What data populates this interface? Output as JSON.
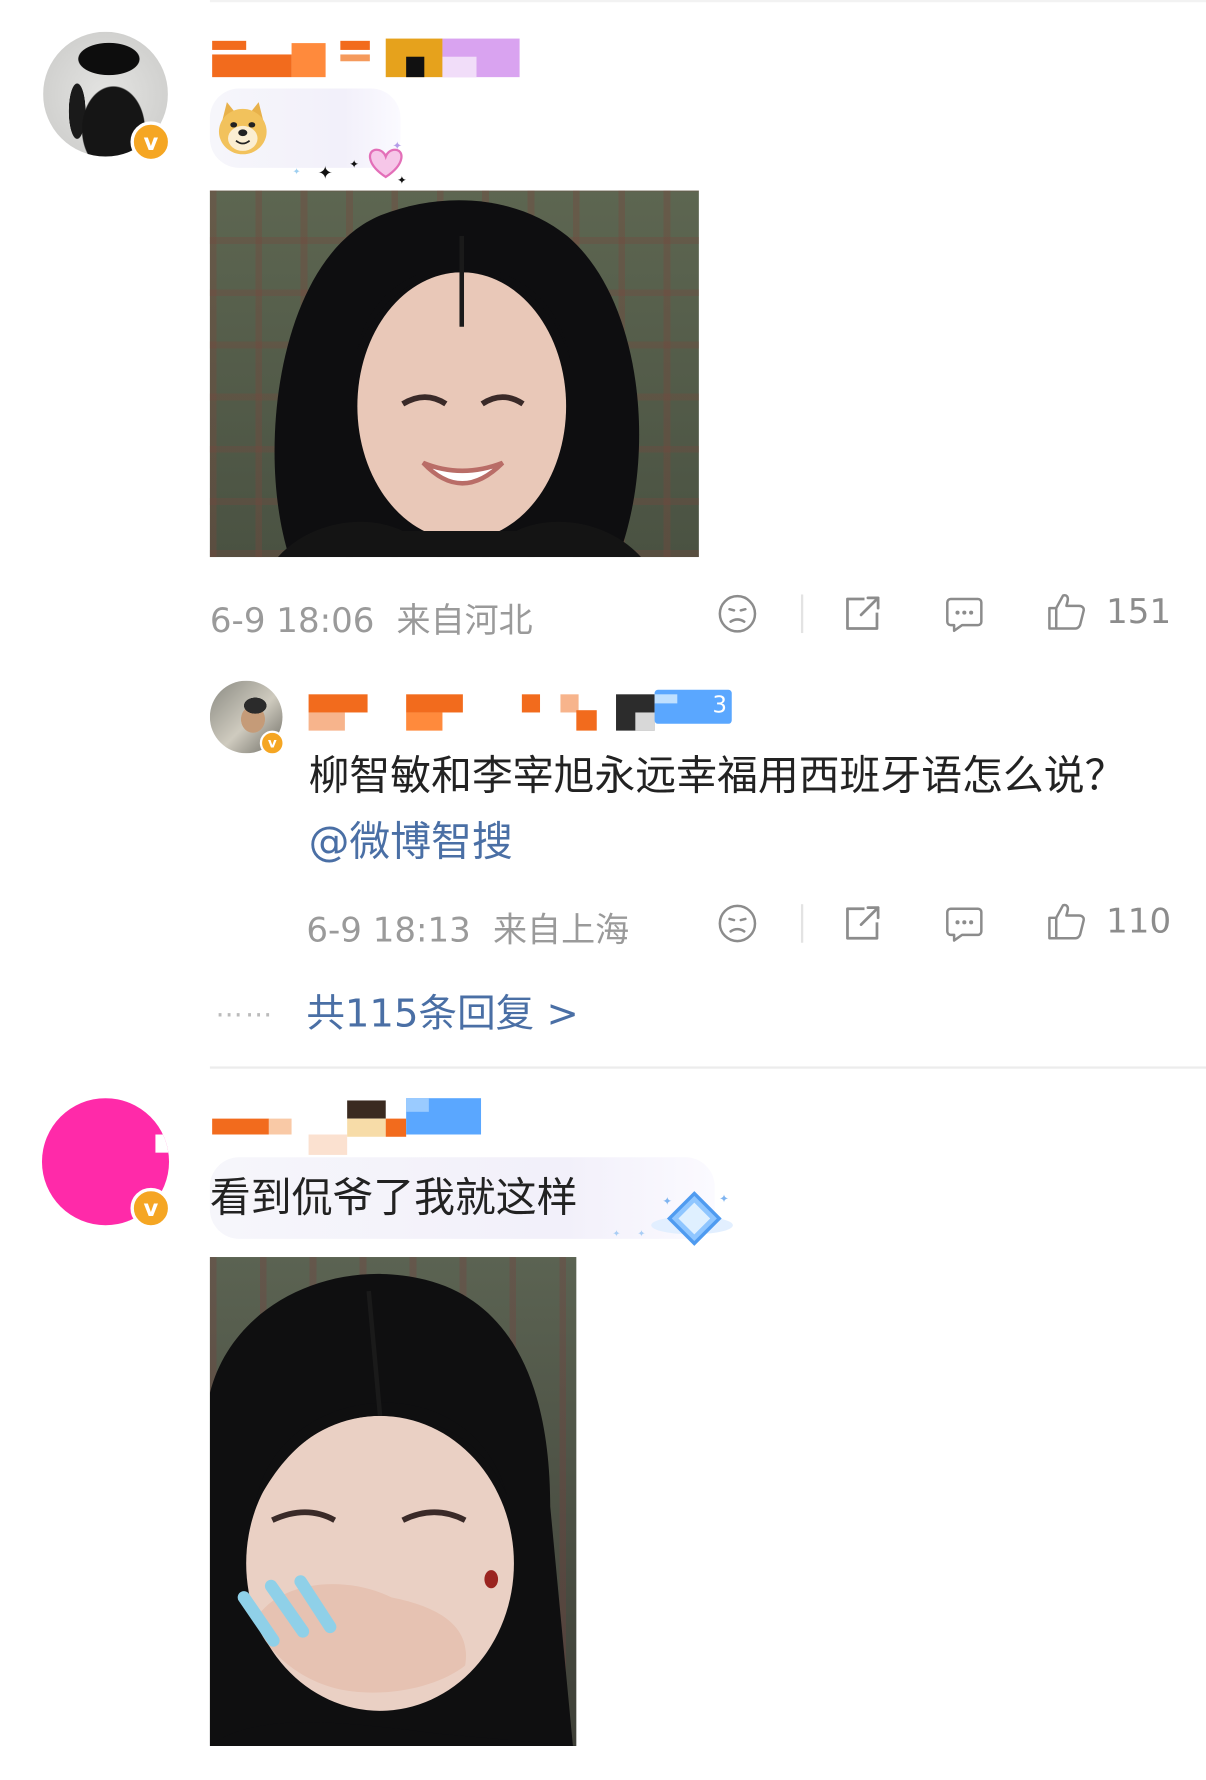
{
  "comments": [
    {
      "time": "6-9 18:06",
      "location": "来自河北",
      "likes": "151",
      "reply": {
        "username_tag": "3",
        "text": "柳智敏和李宰旭永远幸福用西班牙语怎么说？",
        "mention": "@微博智搜",
        "time": "6-9 18:13",
        "location": "来自上海",
        "likes": "110"
      },
      "more_replies": "共115条回复 >",
      "more_dots": "……"
    },
    {
      "text": "看到侃爷了我就这样"
    }
  ],
  "badge_letter": "v",
  "colors": {
    "accent": "#4a6fa5",
    "badge": "#f5a623",
    "avatar_pink": "#ff2aa9"
  }
}
